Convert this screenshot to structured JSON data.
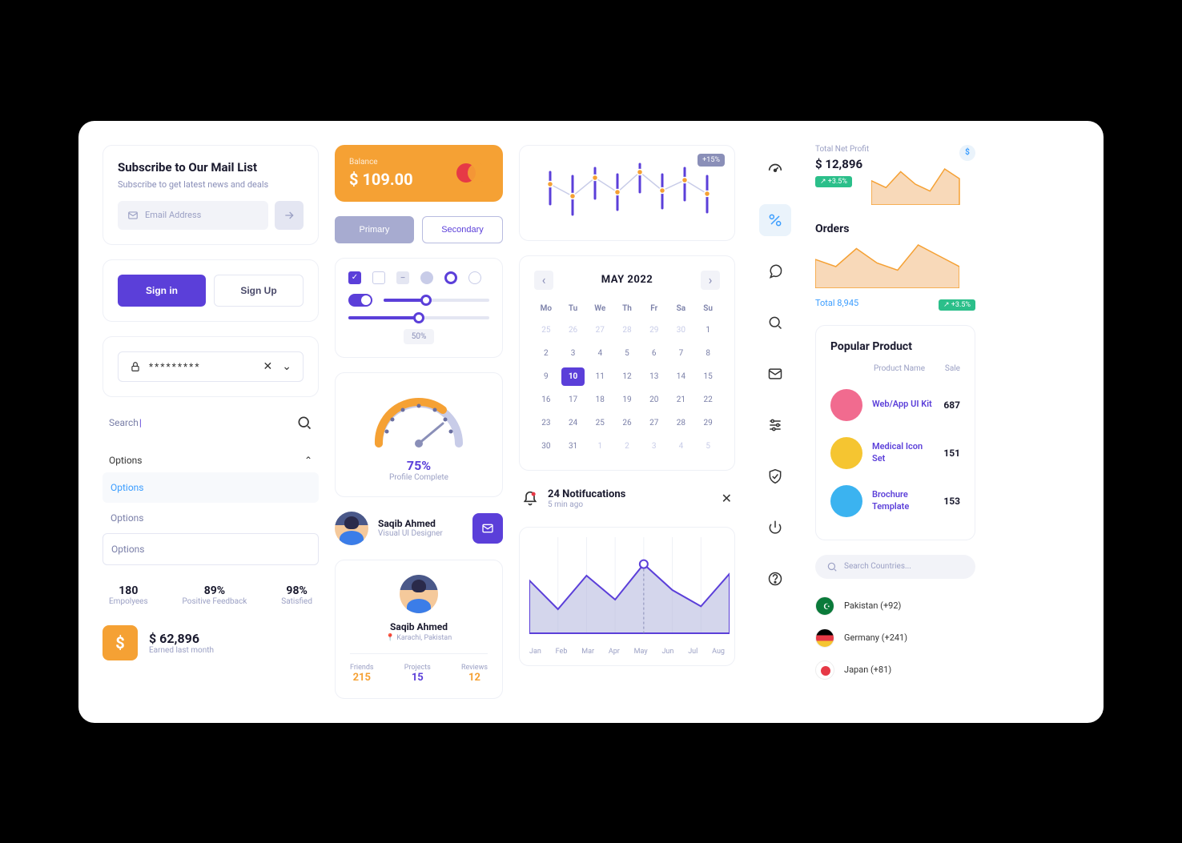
{
  "subscribe": {
    "title": "Subscribe to Our Mail List",
    "subtitle": "Subscribe to get latest news and deals",
    "placeholder": "Email Address"
  },
  "auth": {
    "signin": "Sign in",
    "signup": "Sign Up"
  },
  "password": {
    "masked": "*********"
  },
  "search": {
    "label": "Search"
  },
  "options": {
    "head": "Options",
    "items": [
      "Options",
      "Options",
      "Options"
    ]
  },
  "stats": [
    {
      "value": "180",
      "label": "Empolyees"
    },
    {
      "value": "89%",
      "label": "Positive Feedback"
    },
    {
      "value": "98%",
      "label": "Satisfied"
    }
  ],
  "earned": {
    "amount": "$ 62,896",
    "label": "Earned last month"
  },
  "balance": {
    "label": "Balance",
    "amount": "$ 109.00"
  },
  "pills": {
    "primary": "Primary",
    "secondary": "Secondary"
  },
  "controls": {
    "pct": "50%",
    "slider1": 40,
    "slider2": 50
  },
  "gauge": {
    "pct": "75%",
    "label": "Profile Complete"
  },
  "person": {
    "name": "Saqib Ahmed",
    "role": "Visual UI Designer"
  },
  "profile": {
    "name": "Saqib Ahmed",
    "location": "Karachi, Pakistan",
    "items": [
      {
        "label": "Friends",
        "value": "215"
      },
      {
        "label": "Projects",
        "value": "15"
      },
      {
        "label": "Reviews",
        "value": "12"
      }
    ]
  },
  "spark": {
    "badge": "+15%",
    "points": [
      {
        "x": 20,
        "y": 30,
        "low": 55,
        "high": 15
      },
      {
        "x": 48,
        "y": 45,
        "low": 68,
        "high": 20
      },
      {
        "x": 76,
        "y": 22,
        "low": 48,
        "high": 10
      },
      {
        "x": 104,
        "y": 40,
        "low": 62,
        "high": 18
      },
      {
        "x": 132,
        "y": 15,
        "low": 40,
        "high": 5
      },
      {
        "x": 160,
        "y": 38,
        "low": 60,
        "high": 18
      },
      {
        "x": 188,
        "y": 25,
        "low": 50,
        "high": 10
      },
      {
        "x": 216,
        "y": 42,
        "low": 65,
        "high": 20
      }
    ]
  },
  "calendar": {
    "title": "MAY 2022",
    "dow": [
      "Mo",
      "Tu",
      "We",
      "Th",
      "Fr",
      "Sa",
      "Su"
    ],
    "days": [
      {
        "n": 25,
        "m": true
      },
      {
        "n": 26,
        "m": true
      },
      {
        "n": 27,
        "m": true
      },
      {
        "n": 28,
        "m": true
      },
      {
        "n": 29,
        "m": true
      },
      {
        "n": 30,
        "m": true
      },
      {
        "n": 1
      },
      {
        "n": 2
      },
      {
        "n": 3
      },
      {
        "n": 4
      },
      {
        "n": 5
      },
      {
        "n": 6
      },
      {
        "n": 7
      },
      {
        "n": 8
      },
      {
        "n": 9
      },
      {
        "n": 10,
        "sel": true
      },
      {
        "n": 11
      },
      {
        "n": 12
      },
      {
        "n": 13
      },
      {
        "n": 14
      },
      {
        "n": 15
      },
      {
        "n": 16
      },
      {
        "n": 17
      },
      {
        "n": 18
      },
      {
        "n": 19
      },
      {
        "n": 20
      },
      {
        "n": 21
      },
      {
        "n": 22
      },
      {
        "n": 23
      },
      {
        "n": 24
      },
      {
        "n": 25
      },
      {
        "n": 26
      },
      {
        "n": 27
      },
      {
        "n": 28
      },
      {
        "n": 29
      },
      {
        "n": 30
      },
      {
        "n": 31
      },
      {
        "n": 1,
        "m": true
      },
      {
        "n": 2,
        "m": true
      },
      {
        "n": 3,
        "m": true
      },
      {
        "n": 4,
        "m": true
      },
      {
        "n": 5,
        "m": true
      }
    ]
  },
  "notif": {
    "title": "24 Notifucations",
    "time": "5 min ago"
  },
  "chart_data": {
    "type": "area",
    "categories": [
      "Jan",
      "Feb",
      "Mar",
      "Apr",
      "May",
      "Jun",
      "Jul",
      "Aug"
    ],
    "values": [
      55,
      25,
      60,
      35,
      72,
      45,
      28,
      62
    ],
    "ylim": [
      0,
      100
    ],
    "marker_index": 4,
    "title": "",
    "xlabel": "",
    "ylabel": ""
  },
  "metrics": {
    "profit": {
      "label": "Total Net Profit",
      "amount": "$ 12,896",
      "pct": "↗ +3.5%"
    },
    "orders": {
      "title": "Orders",
      "total": "Total 8,945",
      "pct": "↗ +3.5%"
    },
    "orders_spark": [
      40,
      30,
      55,
      35,
      25,
      60,
      45,
      30
    ],
    "profit_spark": [
      35,
      25,
      48,
      30,
      20,
      52,
      38
    ]
  },
  "popular": {
    "title": "Popular Product",
    "thead": {
      "name": "Product Name",
      "sale": "Sale"
    },
    "items": [
      {
        "color": "#f16b8f",
        "name": "Web/App UI Kit",
        "sale": "687"
      },
      {
        "color": "#f5c531",
        "name": "Medical Icon Set",
        "sale": "151"
      },
      {
        "color": "#3bb3f0",
        "name": "Brochure Template",
        "sale": "153"
      }
    ]
  },
  "countries": {
    "placeholder": "Search Countries...",
    "items": [
      {
        "name": "Pakistan (+92)",
        "bg": "#0a7a3a"
      },
      {
        "name": "Germany (+241)",
        "bg": "linear-gradient(#000 33%,#e63946 33% 66%,#f5c531 66%)"
      },
      {
        "name": "Japan (+81)",
        "bg": "#fff"
      }
    ]
  }
}
